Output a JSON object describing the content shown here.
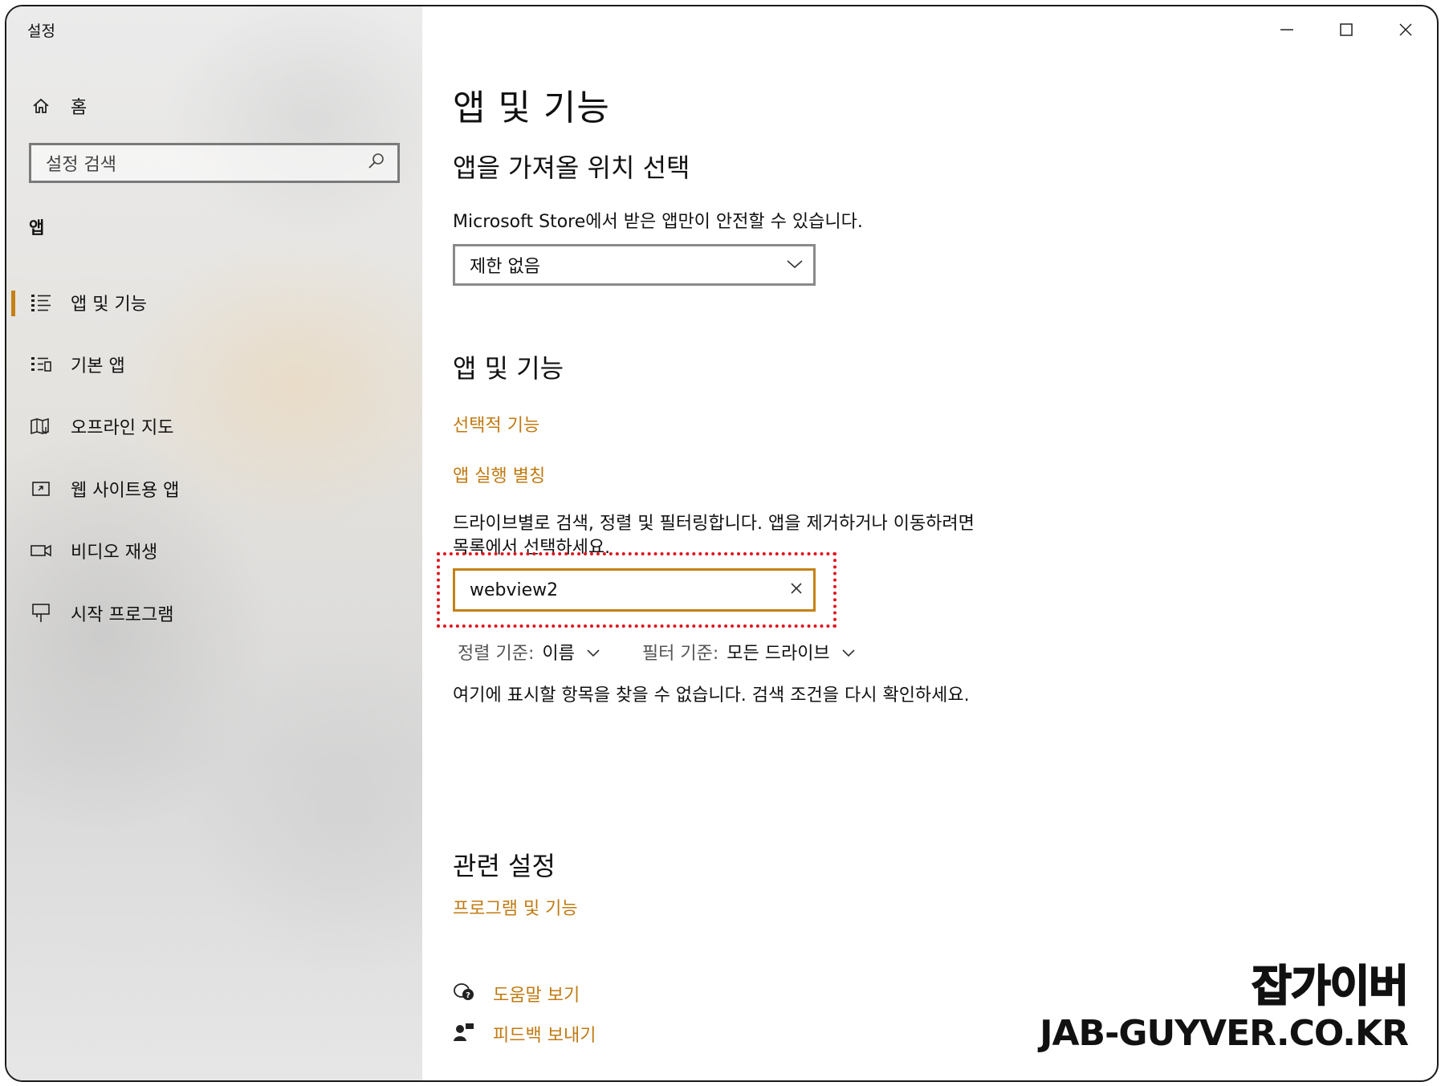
{
  "window": {
    "title": "설정",
    "minimize_icon": "minimize-icon",
    "maximize_icon": "maximize-icon",
    "close_icon": "close-icon"
  },
  "sidebar": {
    "home_label": "홈",
    "search_placeholder": "설정 검색",
    "section_title": "앱",
    "items": [
      {
        "label": "앱 및 기능",
        "icon": "apps-list-icon",
        "active": true
      },
      {
        "label": "기본 앱",
        "icon": "default-apps-icon",
        "active": false
      },
      {
        "label": "오프라인 지도",
        "icon": "map-icon",
        "active": false
      },
      {
        "label": "웹 사이트용 앱",
        "icon": "web-app-icon",
        "active": false
      },
      {
        "label": "비디오 재생",
        "icon": "video-icon",
        "active": false
      },
      {
        "label": "시작 프로그램",
        "icon": "startup-icon",
        "active": false
      }
    ]
  },
  "main": {
    "page_title": "앱 및 기능",
    "install_source": {
      "heading": "앱을 가져올 위치 선택",
      "description": "Microsoft Store에서 받은 앱만이 안전할 수 있습니다.",
      "dropdown_value": "제한 없음"
    },
    "apps_features": {
      "heading": "앱 및 기능",
      "optional_features_link": "선택적 기능",
      "app_aliases_link": "앱 실행 별칭",
      "description_line1": "드라이브별로 검색, 정렬 및 필터링합니다. 앱을 제거하거나 이동하려면",
      "description_line2": "목록에서 선택하세요.",
      "search_value": "webview2",
      "sort_label": "정렬 기준:",
      "sort_value": "이름",
      "filter_label": "필터 기준:",
      "filter_value": "모든 드라이브",
      "empty_message": "여기에 표시할 항목을 찾을 수 없습니다. 검색 조건을 다시 확인하세요."
    },
    "related": {
      "heading": "관련 설정",
      "programs_link": "프로그램 및 기능"
    },
    "help": {
      "get_help": "도움말 보기",
      "give_feedback": "피드백 보내기"
    }
  },
  "watermark": {
    "korean": "잡가이버",
    "domain": "JAB-GUYVER.CO.KR"
  },
  "colors": {
    "accent": "#c07a12",
    "highlight": "#e0141e"
  }
}
